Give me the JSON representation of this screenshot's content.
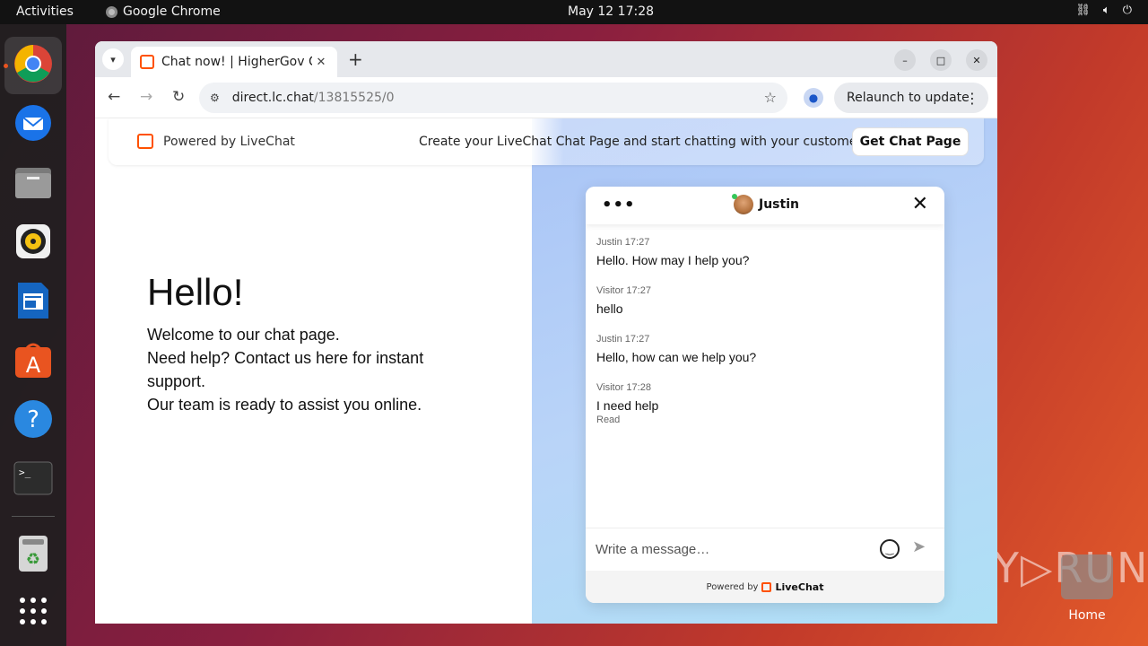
{
  "topbar": {
    "activities": "Activities",
    "app_name": "Google Chrome",
    "clock": "May 12  17:28"
  },
  "dock": {
    "items": [
      "chrome-icon",
      "thunderbird-icon",
      "files-icon",
      "rhythmbox-icon",
      "writer-icon",
      "software-icon",
      "help-icon",
      "terminal-icon",
      "trash-icon",
      "apps-grid-icon"
    ]
  },
  "desktop": {
    "home_label": "Home",
    "watermark": "ANY▷RUN"
  },
  "browser": {
    "tab_title": "Chat now! | HigherGov C",
    "url_host": "direct.lc.chat",
    "url_path": "/13815525/0",
    "relaunch_label": "Relaunch to update"
  },
  "banner": {
    "powered": "Powered by LiveChat",
    "cta": "Create your LiveChat Chat Page and start chatting with your customers.",
    "button": "Get Chat Page"
  },
  "page": {
    "heading": "Hello!",
    "line1": "Welcome to our chat page.",
    "line2": "Need help? Contact us here for instant support.",
    "line3": "Our team is ready to assist you online."
  },
  "chat": {
    "agent": "Justin",
    "messages": [
      {
        "meta": "Justin 17:27",
        "text": "Hello. How may I help you?"
      },
      {
        "meta": "Visitor 17:27",
        "text": "hello"
      },
      {
        "meta": "Justin 17:27",
        "text": "Hello, how can we help you?"
      },
      {
        "meta": "Visitor 17:28",
        "text": "I need help",
        "status": "Read"
      }
    ],
    "placeholder": "Write a message…",
    "footer_powered": "Powered by",
    "footer_brand": "LiveChat"
  }
}
